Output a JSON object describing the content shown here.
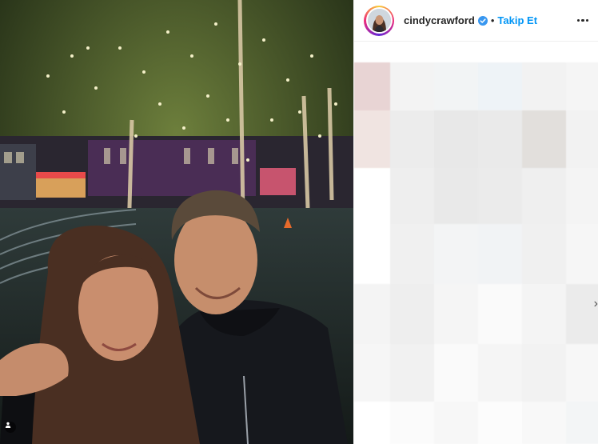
{
  "post": {
    "username": "cindycrawford",
    "separator": "•",
    "follow_label": "Takip Et",
    "more_options_icon": "more-horizontal-icon",
    "verified_icon": "verified-badge-icon",
    "user_tag_icon": "person-icon",
    "next_icon": "chevron-right-icon",
    "next_glyph": "›"
  },
  "colors": {
    "accent": "#0095f6",
    "text": "#262626",
    "verified": "#3897f0"
  }
}
